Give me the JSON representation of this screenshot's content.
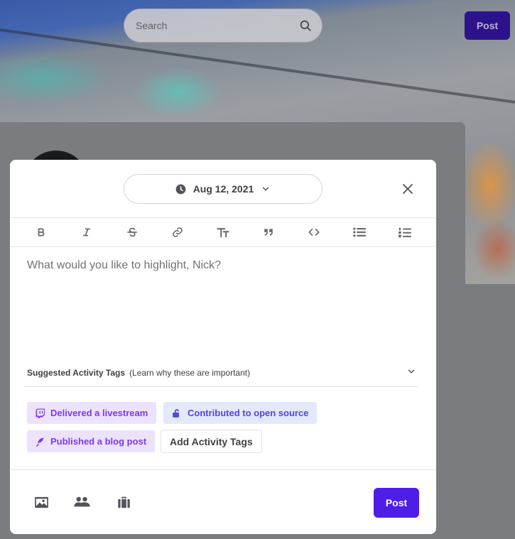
{
  "page": {
    "search_placeholder": "Search",
    "post_label": "Post"
  },
  "modal": {
    "date": "Aug 12, 2021",
    "toolbar": [
      "bold",
      "italic",
      "strikethrough",
      "link",
      "heading",
      "quote",
      "code",
      "bulleted-list",
      "numbered-list"
    ],
    "editor_placeholder": "What would you like to highlight, Nick?",
    "tags": {
      "title": "Suggested Activity Tags",
      "note": "(Learn why these are important)",
      "items": [
        {
          "label": "Delivered a livestream",
          "icon": "twitch-icon",
          "color": "#7c3aed"
        },
        {
          "label": "Contributed to open source",
          "icon": "unlock-icon",
          "color": "#4f46e5"
        },
        {
          "label": "Published a blog post",
          "icon": "feather-icon",
          "color": "#7c3aed"
        }
      ],
      "add_label": "Add Activity Tags"
    },
    "footer": {
      "attachments": [
        "image-icon",
        "people-icon",
        "briefcase-icon"
      ],
      "post_label": "Post"
    }
  },
  "colors": {
    "accent": "#4f1de8",
    "tag_purple_bg": "#ede2fb",
    "tag_blue_bg": "#e4e8fb"
  }
}
